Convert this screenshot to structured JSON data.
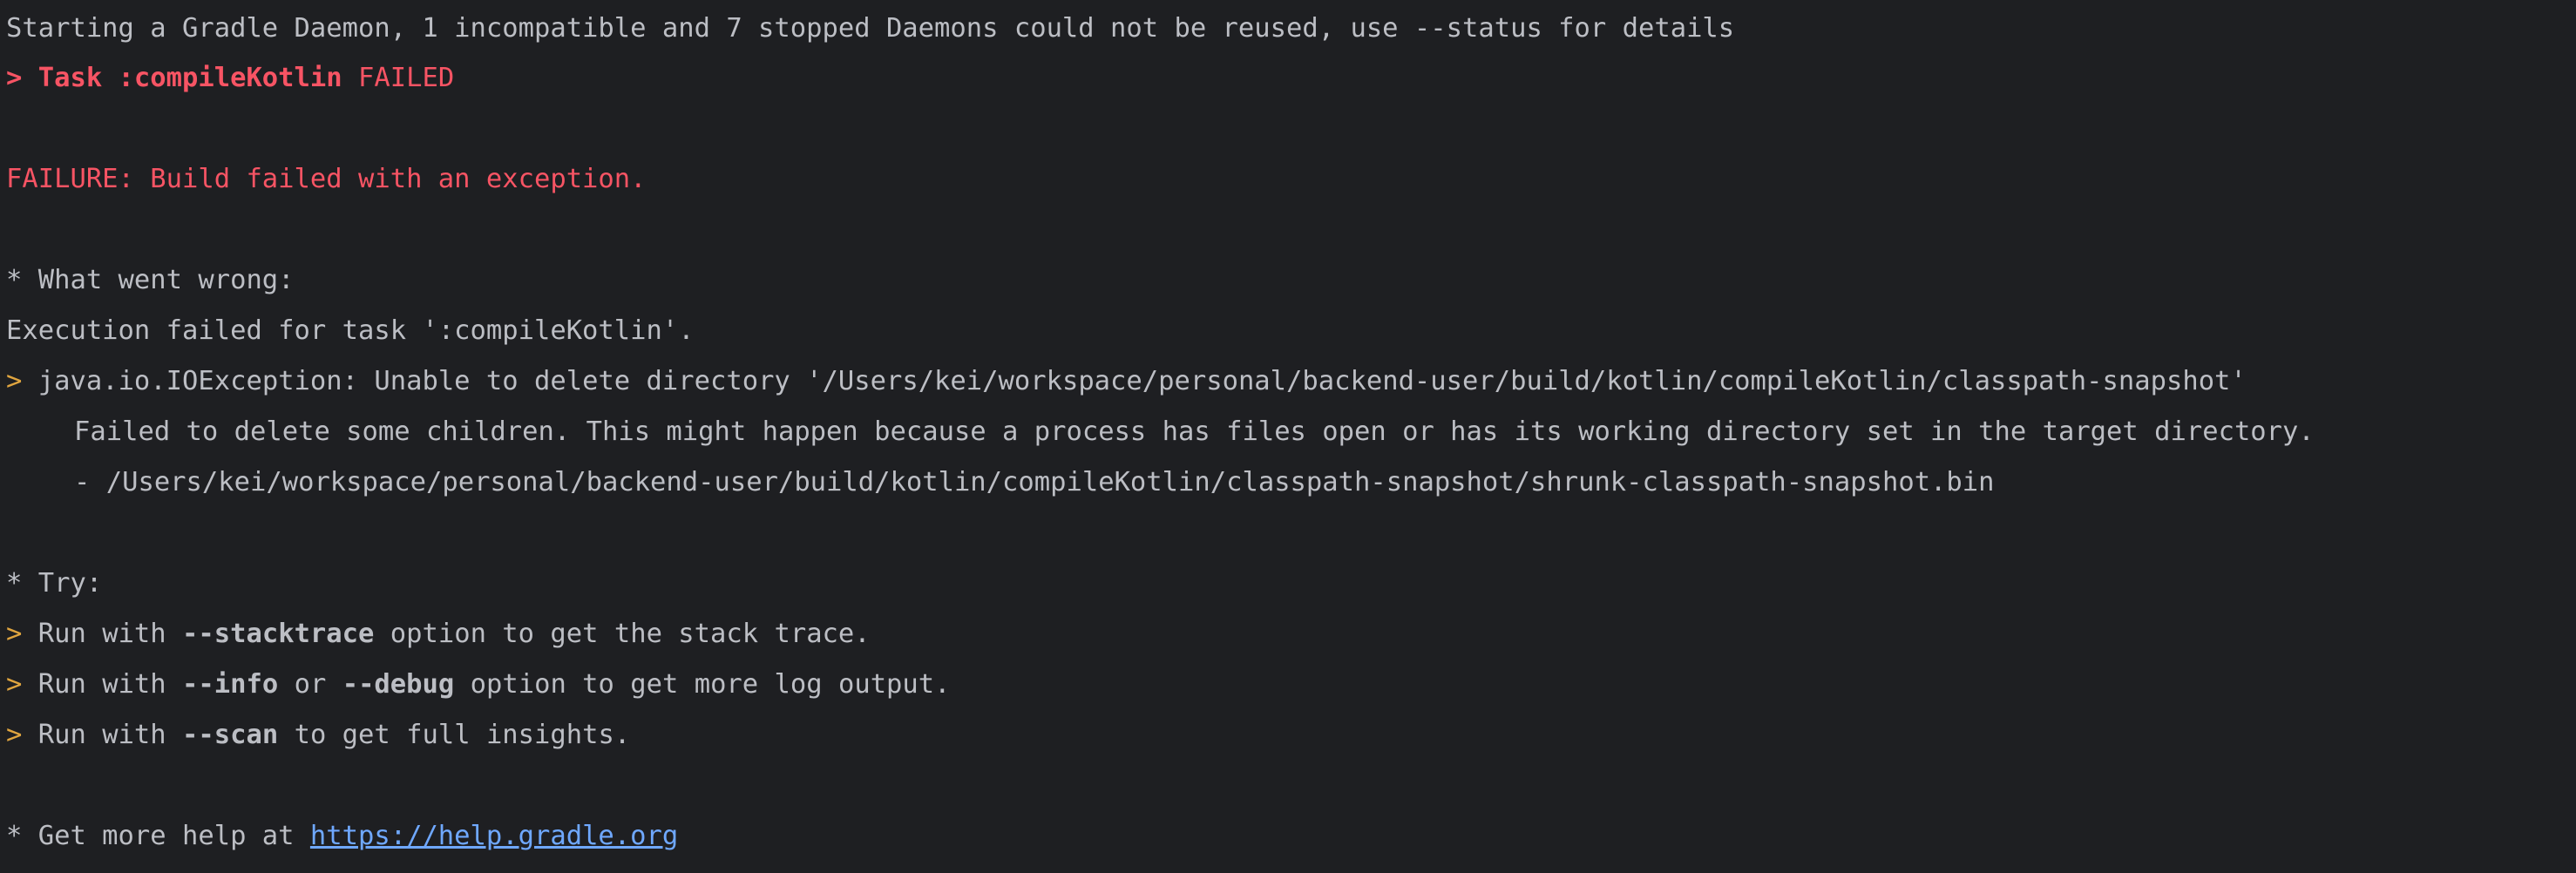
{
  "console": {
    "daemon_message": "Starting a Gradle Daemon, 1 incompatible and 7 stopped Daemons could not be reused, use --status for details",
    "task": {
      "prefix": "> Task :compileKotlin",
      "status": "FAILED"
    },
    "failure": "FAILURE: Build failed with an exception.",
    "wrong": {
      "heading": "* What went wrong:",
      "execution": "Execution failed for task ':compileKotlin'.",
      "marker": ">",
      "exception": "java.io.IOException: Unable to delete directory '/Users/kei/workspace/personal/backend-user/build/kotlin/compileKotlin/classpath-snapshot'",
      "detail": "Failed to delete some children. This might happen because a process has files open or has its working directory set in the target directory.",
      "file": "- /Users/kei/workspace/personal/backend-user/build/kotlin/compileKotlin/classpath-snapshot/shrunk-classpath-snapshot.bin"
    },
    "try": {
      "heading": "* Try:",
      "marker": ">",
      "run_with": "Run with",
      "stacktrace_flag": "--stacktrace",
      "stacktrace_rest": "option to get the stack trace.",
      "info_flag": "--info",
      "or": "or",
      "debug_flag": "--debug",
      "info_rest": "option to get more log output.",
      "scan_flag": "--scan",
      "scan_rest": "to get full insights."
    },
    "help": {
      "prefix": "* Get more help at",
      "link": "https://help.gradle.org"
    }
  },
  "colors": {
    "background": "#1e1f22",
    "text": "#bcbec4",
    "error": "#f75464",
    "prompt": "#e0a53f",
    "link": "#6fa8ff"
  }
}
